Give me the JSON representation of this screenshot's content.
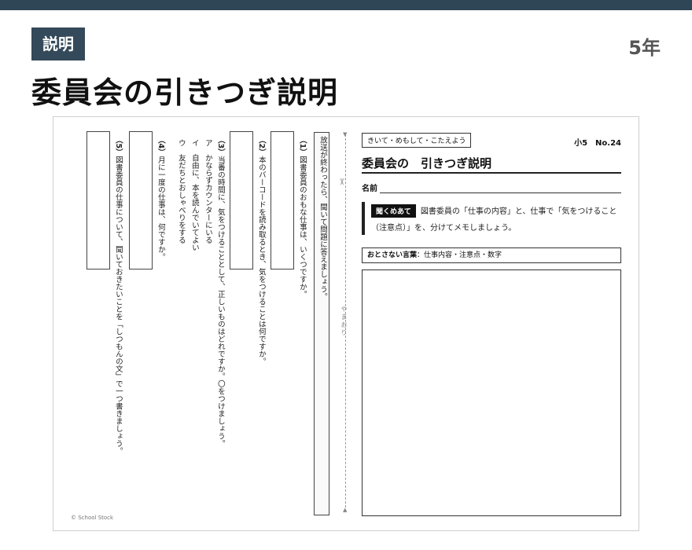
{
  "header": {
    "tag": "説明",
    "grade": "5年",
    "title": "委員会の引きつぎ説明"
  },
  "worksheet": {
    "instruction": "放送が終わったら、聞いて問題に答えましょう。",
    "fold_label": "やまおり",
    "questions": [
      {
        "num": "（1）",
        "text": "図書委員のおもな仕事は、いくつですか。"
      },
      {
        "num": "（2）",
        "text": "本のバーコードを読み取るとき、気をつけることは何ですか。"
      },
      {
        "num": "（3）",
        "text": "当番の時間に、気をつけることとして、正しいものはどれですか。〇をつけましょう。"
      },
      {
        "num": "ア",
        "text": "かならずカウンターにいる"
      },
      {
        "num": "イ",
        "text": "自由に、本を読んでいてよい"
      },
      {
        "num": "ウ",
        "text": "友だちとおしゃべりをする"
      },
      {
        "num": "（4）",
        "text": "月に一度の仕事は、何ですか。"
      },
      {
        "num": "（5）",
        "text": "図書委員の仕事について、聞いておきたいことを「しつもんの文」で一つ書きましょう。"
      }
    ],
    "right": {
      "tag": "きいて・めもして・こたえよう",
      "number": "小5　No.24",
      "title": "委員会の　引きつぎ説明",
      "name_label": "名前",
      "listen_label": "聞くめあて",
      "listen_text": "図書委員の「仕事の内容」と、仕事で「気をつけること（注意点）」を、分けてメモしましょう。",
      "keywords_label": "おとさない言葉",
      "keywords_text": "：仕事内容・注意点・数字"
    },
    "copyright": "© School Stock"
  }
}
